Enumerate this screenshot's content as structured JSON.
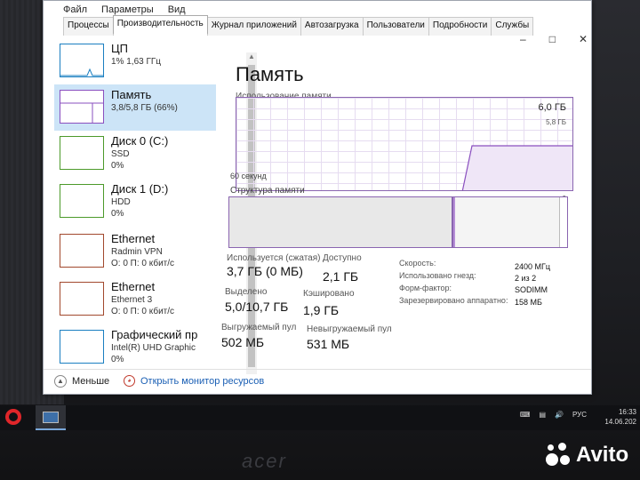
{
  "menu": [
    "Файл",
    "Параметры",
    "Вид"
  ],
  "tabs": [
    {
      "label": "Процессы",
      "active": false
    },
    {
      "label": "Производительность",
      "active": true
    },
    {
      "label": "Журнал приложений",
      "active": false
    },
    {
      "label": "Автозагрузка",
      "active": false
    },
    {
      "label": "Пользователи",
      "active": false
    },
    {
      "label": "Подробности",
      "active": false
    },
    {
      "label": "Службы",
      "active": false
    }
  ],
  "sidebar": [
    {
      "title": "ЦП",
      "lines": [
        "1% 1,63 ГГц"
      ],
      "color": "#1a7fc1",
      "selected": false
    },
    {
      "title": "Память",
      "lines": [
        "3,8/5,8 ГБ (66%)"
      ],
      "color": "#8a4fbf",
      "selected": true
    },
    {
      "title": "Диск 0 (C:)",
      "lines": [
        "SSD",
        "0%"
      ],
      "color": "#4c9a2a",
      "selected": false
    },
    {
      "title": "Диск 1 (D:)",
      "lines": [
        "HDD",
        "0%"
      ],
      "color": "#4c9a2a",
      "selected": false
    },
    {
      "title": "Ethernet",
      "lines": [
        "Radmin VPN",
        "О: 0 П: 0 кбит/с"
      ],
      "color": "#a2482d",
      "selected": false
    },
    {
      "title": "Ethernet",
      "lines": [
        "Ethernet 3",
        "О: 0 П: 0 кбит/с"
      ],
      "color": "#a2482d",
      "selected": false
    },
    {
      "title": "Графический пр",
      "lines": [
        "Intel(R) UHD Graphic",
        "0%"
      ],
      "color": "#1a7fc1",
      "selected": false
    }
  ],
  "main": {
    "title": "Память",
    "usage_label": "Использование памяти",
    "max": "6,0 ГБ",
    "chart_max": "5,8 ГБ",
    "x_left": "60 секунд",
    "x_right": "0",
    "structure_label": "Структура памяти",
    "stats": [
      {
        "label": "Используется (сжатая)",
        "value": "3,7 ГБ (0 МБ)"
      },
      {
        "label": "Доступно",
        "value": "2,1 ГБ"
      },
      {
        "label": "Выделено",
        "value": "5,0/10,7 ГБ"
      },
      {
        "label": "Кэшировано",
        "value": "1,9 ГБ"
      },
      {
        "label": "Выгружаемый пул",
        "value": "502 МБ"
      },
      {
        "label": "Невыгружаемый пул",
        "value": "531 МБ"
      }
    ],
    "kv": [
      {
        "k": "Скорость:",
        "v": "2400 МГц"
      },
      {
        "k": "Использовано гнезд:",
        "v": "2 из 2"
      },
      {
        "k": "Форм-фактор:",
        "v": "SODIMM"
      },
      {
        "k": "Зарезервировано аппаратно:",
        "v": "158 МБ"
      }
    ]
  },
  "footer": {
    "less": "Меньше",
    "resmon": "Открыть монитор ресурсов"
  },
  "taskbar": {
    "lang": "РУС",
    "time": "16:33",
    "date": "14.06.202"
  },
  "overlay": {
    "avito": "Avito"
  }
}
